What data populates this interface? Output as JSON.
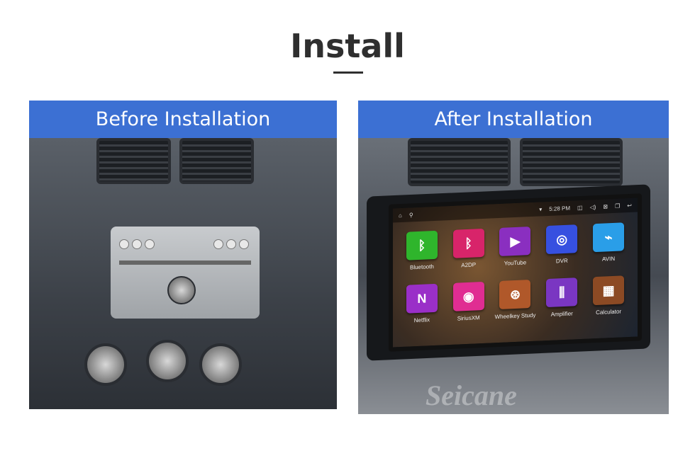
{
  "title": "Install",
  "before": {
    "label": "Before Installation"
  },
  "after": {
    "label": "After  Installation",
    "status": {
      "time": "5:28 PM"
    },
    "apps": [
      {
        "label": "Bluetooth",
        "color": "#2fb52c",
        "glyph": "ᛒ",
        "icon": "bluetooth-icon"
      },
      {
        "label": "A2DP",
        "color": "#d8246a",
        "glyph": "ᛒ",
        "icon": "bluetooth-audio-icon"
      },
      {
        "label": "YouTube",
        "color": "#8a2fc0",
        "glyph": "▶",
        "icon": "youtube-icon"
      },
      {
        "label": "DVR",
        "color": "#3650e0",
        "glyph": "◎",
        "icon": "dvr-icon"
      },
      {
        "label": "AVIN",
        "color": "#2a9ee8",
        "glyph": "⌁",
        "icon": "avin-icon"
      },
      {
        "label": "Netflix",
        "color": "#9a2fc8",
        "glyph": "N",
        "icon": "netflix-icon"
      },
      {
        "label": "SiriusXM",
        "color": "#e02d92",
        "glyph": "◉",
        "icon": "siriusxm-icon"
      },
      {
        "label": "Wheelkey Study",
        "color": "#b0582a",
        "glyph": "⊛",
        "icon": "steering-wheel-icon"
      },
      {
        "label": "Amplifier",
        "color": "#7a36c2",
        "glyph": "⫼",
        "icon": "equalizer-icon"
      },
      {
        "label": "Calculator",
        "color": "#8c4a24",
        "glyph": "▦",
        "icon": "calculator-icon"
      }
    ]
  },
  "watermark": "Seicane"
}
